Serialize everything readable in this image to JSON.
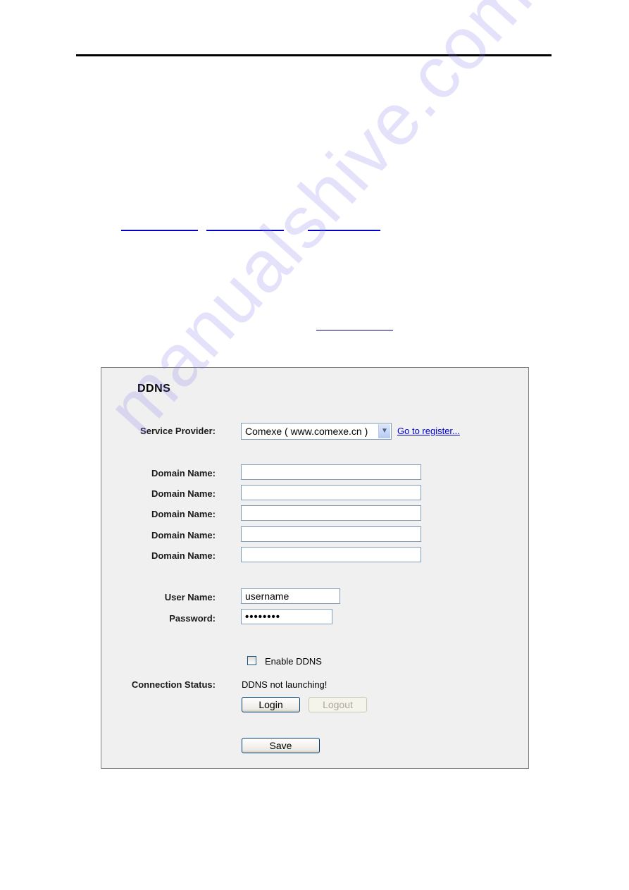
{
  "document": {
    "watermark": "manualshive.com"
  },
  "panel": {
    "title": "DDNS",
    "service_provider": {
      "label": "Service Provider:",
      "selected": "Comexe ( www.comexe.cn )",
      "register_link": "Go to register..."
    },
    "domain_names": [
      {
        "label": "Domain Name:",
        "value": ""
      },
      {
        "label": "Domain Name:",
        "value": ""
      },
      {
        "label": "Domain Name:",
        "value": ""
      },
      {
        "label": "Domain Name:",
        "value": ""
      },
      {
        "label": "Domain Name:",
        "value": ""
      }
    ],
    "user_name": {
      "label": "User Name:",
      "value": "username"
    },
    "password": {
      "label": "Password:",
      "value": "••••••••"
    },
    "enable_ddns": {
      "label": "Enable DDNS",
      "checked": false
    },
    "connection_status": {
      "label": "Connection Status:",
      "value": "DDNS not launching!"
    },
    "buttons": {
      "login": "Login",
      "logout": "Logout",
      "save": "Save"
    }
  }
}
